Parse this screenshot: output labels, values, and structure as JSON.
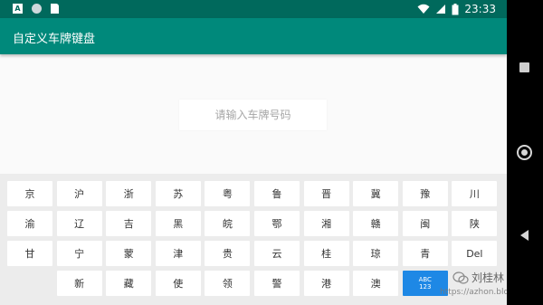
{
  "statusbar": {
    "time": "23:33"
  },
  "appbar": {
    "title": "自定义车牌键盘"
  },
  "input": {
    "placeholder": "请输入车牌号码"
  },
  "keyboard": {
    "row1": [
      "京",
      "沪",
      "浙",
      "苏",
      "粤",
      "鲁",
      "晋",
      "冀",
      "豫",
      "川"
    ],
    "row2": [
      "渝",
      "辽",
      "吉",
      "黑",
      "皖",
      "鄂",
      "湘",
      "赣",
      "闽",
      "陕"
    ],
    "row3": [
      "甘",
      "宁",
      "蒙",
      "津",
      "贵",
      "云",
      "桂",
      "琼",
      "青",
      "Del"
    ],
    "row4": [
      "新",
      "藏",
      "使",
      "领",
      "警",
      "港",
      "澳"
    ],
    "mode_key": {
      "line1": "ABC",
      "line2": "123",
      "color": "#1e88e5"
    }
  },
  "watermark": {
    "name": "刘桂林",
    "url": "https://azhon.blog.cs"
  },
  "colors": {
    "statusbar": "#00695c",
    "appbar": "#00897b",
    "keyboard_bg": "#ececec"
  }
}
